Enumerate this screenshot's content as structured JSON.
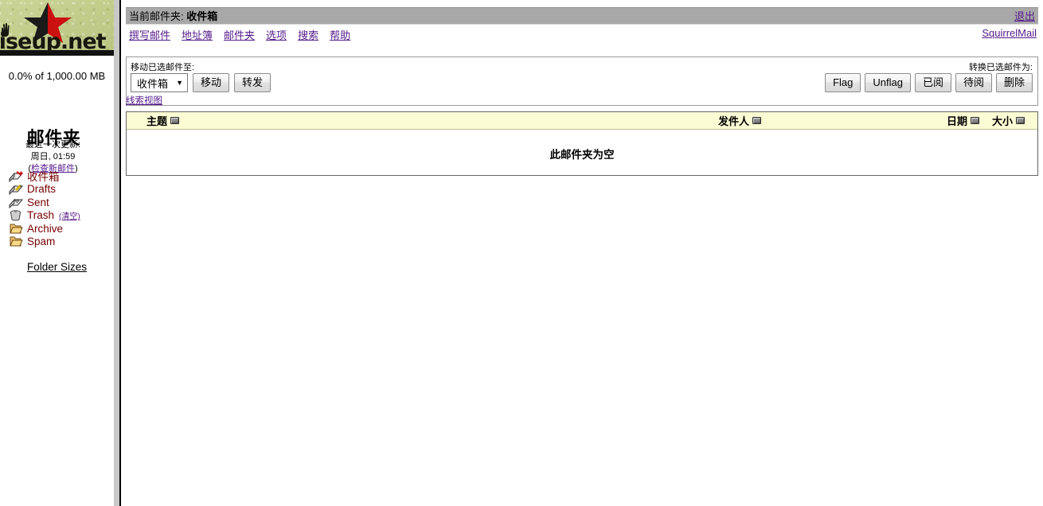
{
  "sidebar": {
    "logo_text": "riseup.net",
    "quota": "0.0% of 1,000.00 MB",
    "folders_heading": "邮件夹",
    "last_update_label": "最近一次更新:",
    "last_update_time": "周日, 01:59",
    "check_mail_open": "(",
    "check_mail_link": "检查新邮件",
    "check_mail_close": ")",
    "folders": [
      {
        "label": "收件箱",
        "icon": "inbox-icon",
        "current": true,
        "sub": ""
      },
      {
        "label": "Drafts",
        "icon": "drafts-icon",
        "current": false,
        "sub": ""
      },
      {
        "label": "Sent",
        "icon": "sent-icon",
        "current": false,
        "sub": ""
      },
      {
        "label": "Trash",
        "icon": "trash-icon",
        "current": false,
        "sub": "(清空)"
      },
      {
        "label": "Archive",
        "icon": "folder-icon",
        "current": false,
        "sub": ""
      },
      {
        "label": "Spam",
        "icon": "folder-icon",
        "current": false,
        "sub": ""
      }
    ],
    "folder_sizes_link": "Folder Sizes"
  },
  "header": {
    "current_folder_label": "当前邮件夹:",
    "current_folder_name": "收件箱",
    "logout_label": "退出",
    "brand_label": "SquirrelMail",
    "nav": [
      {
        "label": "撰写邮件",
        "name": "nav-compose"
      },
      {
        "label": "地址簿",
        "name": "nav-addressbook"
      },
      {
        "label": "邮件夹",
        "name": "nav-folders"
      },
      {
        "label": "选项",
        "name": "nav-options"
      },
      {
        "label": "搜索",
        "name": "nav-search"
      },
      {
        "label": "帮助",
        "name": "nav-help"
      }
    ]
  },
  "toolbar": {
    "move_label": "移动已选邮件至:",
    "convert_label": "转换已选邮件为:",
    "folder_select_value": "收件箱",
    "folder_select_caret": "▼",
    "move_button": "移动",
    "forward_button": "转发",
    "thread_view_link": "线索视图",
    "flag_button": "Flag",
    "unflag_button": "Unflag",
    "read_button": "已阅",
    "unread_button": "待阅",
    "delete_button": "删除"
  },
  "message_list": {
    "columns": {
      "subject": "主题",
      "from": "发件人",
      "date": "日期",
      "size": "大小"
    },
    "empty_text": "此邮件夹为空",
    "rows": []
  }
}
